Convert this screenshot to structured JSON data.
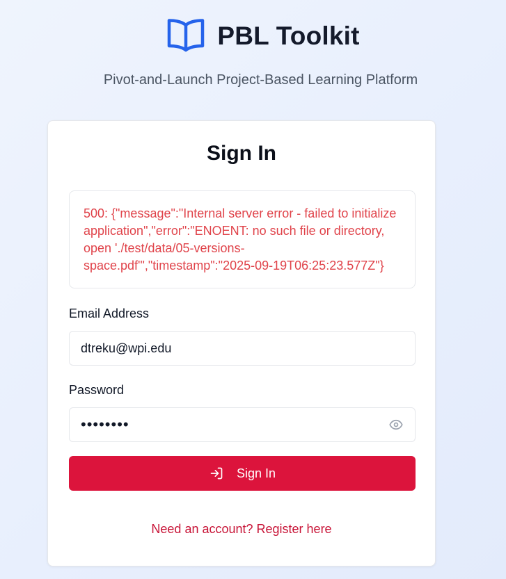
{
  "brand": {
    "title": "PBL Toolkit",
    "icon": "book-open-icon",
    "icon_color": "#2563eb"
  },
  "subtitle": "Pivot-and-Launch Project-Based Learning Platform",
  "form": {
    "title": "Sign In",
    "error_message": "500: {\"message\":\"Internal server error - failed to initialize application\",\"error\":\"ENOENT: no such file or directory, open './test/data/05-versions-space.pdf'\",\"timestamp\":\"2025-09-19T06:25:23.577Z\"}",
    "email": {
      "label": "Email Address",
      "value": "dtreku@wpi.edu"
    },
    "password": {
      "label": "Password",
      "masked_value": "••••••••",
      "toggle_icon": "eye-icon"
    },
    "submit": {
      "label": "Sign In",
      "icon": "log-in-icon"
    },
    "register_link": "Need an account? Register here"
  },
  "colors": {
    "accent": "#dc143c",
    "error_text": "#e0434a",
    "link": "#c81437",
    "brand_blue": "#2563eb"
  }
}
